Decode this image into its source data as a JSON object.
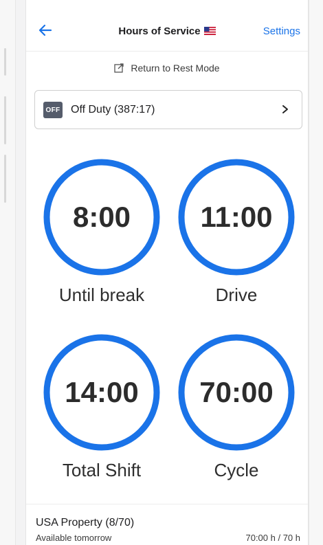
{
  "header": {
    "title": "Hours of Service",
    "settings_label": "Settings",
    "back_icon": "arrow-left-icon",
    "flag_icon": "us-flag-icon"
  },
  "rest_mode": {
    "label": "Return to Rest Mode",
    "icon": "external-link-icon"
  },
  "duty_status": {
    "badge": "OFF",
    "label": "Off Duty (387:17)",
    "chevron_icon": "chevron-right-icon"
  },
  "timers": [
    {
      "value": "8:00",
      "label": "Until break"
    },
    {
      "value": "11:00",
      "label": "Drive"
    },
    {
      "value": "14:00",
      "label": "Total Shift"
    },
    {
      "value": "70:00",
      "label": "Cycle"
    }
  ],
  "cycle_summary": {
    "title": "USA Property (8/70)",
    "subtitle": "Available tomorrow",
    "hours": "70:00 h / 70 h"
  },
  "colors": {
    "accent": "#1a73e8",
    "badge_bg": "#555c6b",
    "text_dark": "#2c2c2c"
  }
}
